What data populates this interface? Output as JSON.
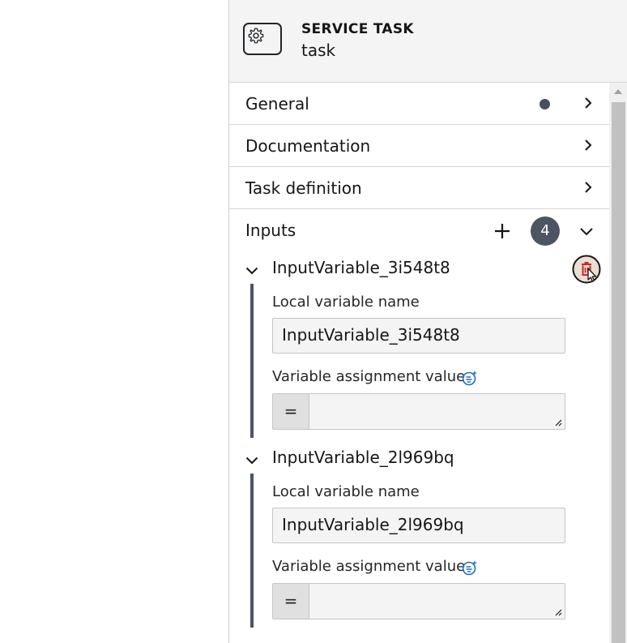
{
  "header": {
    "type_label": "SERVICE TASK",
    "element_name": "task",
    "icon": "gear-icon"
  },
  "groups": [
    {
      "label": "General",
      "has_dot": true
    },
    {
      "label": "Documentation",
      "has_dot": false
    },
    {
      "label": "Task definition",
      "has_dot": false
    }
  ],
  "inputs": {
    "label": "Inputs",
    "count": "4",
    "entries": [
      {
        "title": "InputVariable_3i548t8",
        "local_label": "Local variable name",
        "local_value": "InputVariable_3i548t8",
        "assign_label": "Variable assignment value",
        "feel_symbol": "=",
        "assign_value": ""
      },
      {
        "title": "InputVariable_2l969bq",
        "local_label": "Local variable name",
        "local_value": "InputVariable_2l969bq",
        "assign_label": "Variable assignment value",
        "feel_symbol": "=",
        "assign_value": ""
      }
    ]
  },
  "colors": {
    "header_bg": "#f4f4f4",
    "badge_bg": "#4c5561",
    "feel_blue": "#1a6fc9",
    "trash_red": "#d3212c"
  }
}
